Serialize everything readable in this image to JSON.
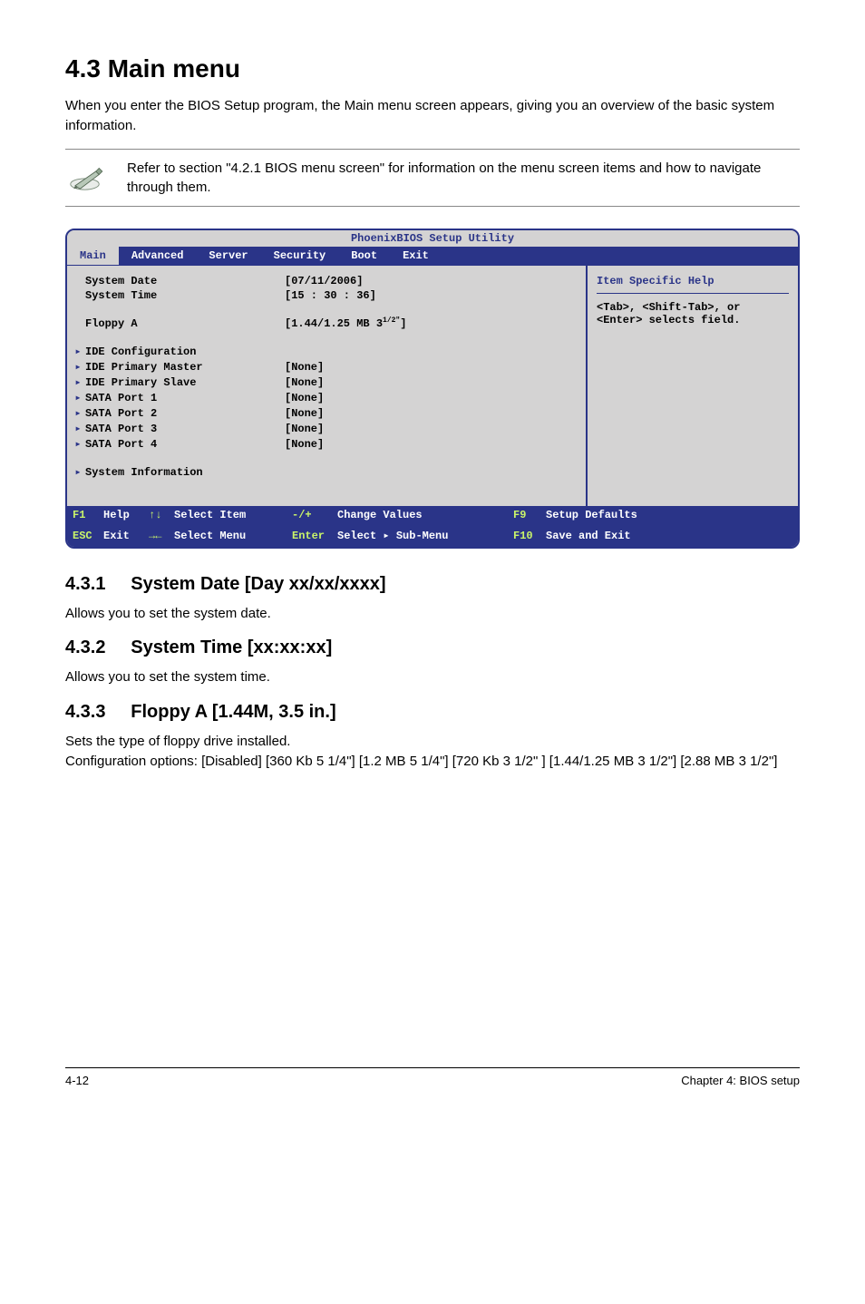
{
  "heading": "4.3      Main menu",
  "intro": "When you enter the BIOS Setup program, the Main menu screen appears, giving you an overview of the basic system information.",
  "note": "Refer to section \"4.2.1 BIOS menu screen\" for information on the menu screen items and how to navigate through them.",
  "bios": {
    "titlebar": "PhoenixBIOS Setup Utility",
    "tabs": [
      "Main",
      "Advanced",
      "Server",
      "Security",
      "Boot",
      "Exit"
    ],
    "rows": {
      "sysdate_lbl": "System Date",
      "sysdate_val": "[07/11/2006]",
      "systime_lbl": "System Time",
      "systime_val": "[15 : 30 : 36]",
      "floppy_lbl": "Floppy A",
      "floppy_val_pre": "[1.44/1.25 MB 3",
      "floppy_val_sup": "1/2\"",
      "floppy_val_post": "]",
      "idecfg": "IDE Configuration",
      "ide_pm": "IDE Primary Master",
      "ide_ps": "IDE Primary Slave",
      "sata1": "SATA Port 1",
      "sata2": "SATA Port 2",
      "sata3": "SATA Port 3",
      "sata4": "SATA Port 4",
      "sysinfo": "System Information",
      "none": "[None]"
    },
    "help_title": "Item Specific Help",
    "help_body": "<Tab>, <Shift-Tab>, or <Enter> selects field.",
    "foot1": {
      "k1": "F1",
      "l1": "Help",
      "arr1": "↑↓",
      "a1": "Select Item",
      "k2": "-/+",
      "l2": "Change Values",
      "k3": "F9",
      "a3": "Setup Defaults"
    },
    "foot2": {
      "k1": "ESC",
      "l1": "Exit",
      "arr1": "→←",
      "a1": "Select Menu",
      "k2": "Enter",
      "l2": "Select ▸ Sub-Menu",
      "k3": "F10",
      "a3": "Save and Exit"
    }
  },
  "sections": [
    {
      "num": "4.3.1",
      "title": "System Date [Day xx/xx/xxxx]",
      "body": "Allows you to set the system date."
    },
    {
      "num": "4.3.2",
      "title": "System Time [xx:xx:xx]",
      "body": "Allows you to set the system time."
    },
    {
      "num": "4.3.3",
      "title": "Floppy A [1.44M, 3.5 in.]",
      "body": "Sets the type of floppy drive installed.\nConfiguration options: [Disabled] [360 Kb  5 1/4\"] [1.2 MB  5 1/4\"] [720 Kb  3 1/2\" ] [1.44/1.25 MB 3 1/2\"] [2.88 MB  3 1/2\"]"
    }
  ],
  "footer": {
    "left": "4-12",
    "right": "Chapter 4: BIOS setup"
  }
}
